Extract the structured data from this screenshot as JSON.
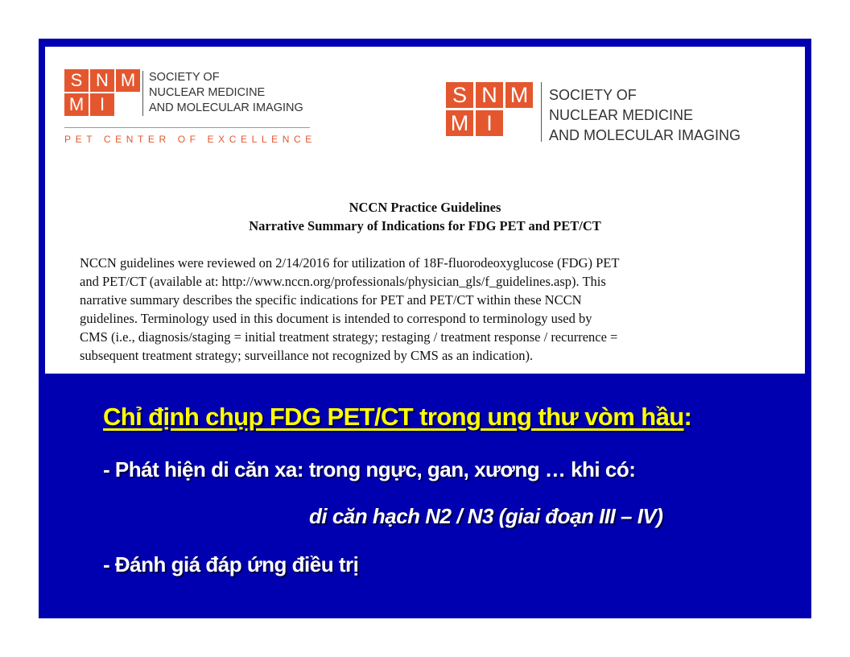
{
  "logo_left": {
    "tiles": [
      "S",
      "N",
      "M",
      "M",
      "I"
    ],
    "name_lines": [
      "SOCIETY OF",
      "NUCLEAR MEDICINE",
      "AND MOLECULAR IMAGING"
    ],
    "tagline": "PET CENTER OF EXCELLENCE"
  },
  "logo_right": {
    "tiles": [
      "S",
      "N",
      "M",
      "M",
      "I"
    ],
    "name_lines": [
      "SOCIETY OF",
      "NUCLEAR MEDICINE",
      "AND MOLECULAR IMAGING"
    ]
  },
  "document": {
    "title_line1": "NCCN Practice Guidelines",
    "title_line2": "Narrative Summary of Indications for FDG PET and PET/CT",
    "body_lines": [
      "NCCN guidelines were reviewed on 2/14/2016 for utilization of 18F-fluorodeoxyglucose (FDG) PET",
      "and PET/CT (available at: http://www.nccn.org/professionals/physician_gls/f_guidelines.asp). This",
      "narrative summary describes the specific indications for PET and PET/CT within these NCCN",
      "guidelines. Terminology used in this document is intended to correspond to terminology used by",
      "CMS (i.e., diagnosis/staging = initial treatment strategy; restaging / treatment response / recurrence =",
      "subsequent treatment strategy; surveillance not recognized by CMS as an indication)."
    ]
  },
  "slide": {
    "heading": "Chỉ định chụp FDG PET/CT trong ung thư vòm hầu",
    "heading_colon": ":",
    "bullet1": "- Phát hiện di căn xa: trong ngực, gan, xương … khi có:",
    "bullet1_cont": "di căn hạch N2 / N3 (giai đoạn III – IV)",
    "bullet2": "- Đánh giá đáp ứng điều trị"
  },
  "colors": {
    "slide_bg": "#0000b0",
    "heading": "#ffff00",
    "logo_orange": "#e4572e"
  }
}
